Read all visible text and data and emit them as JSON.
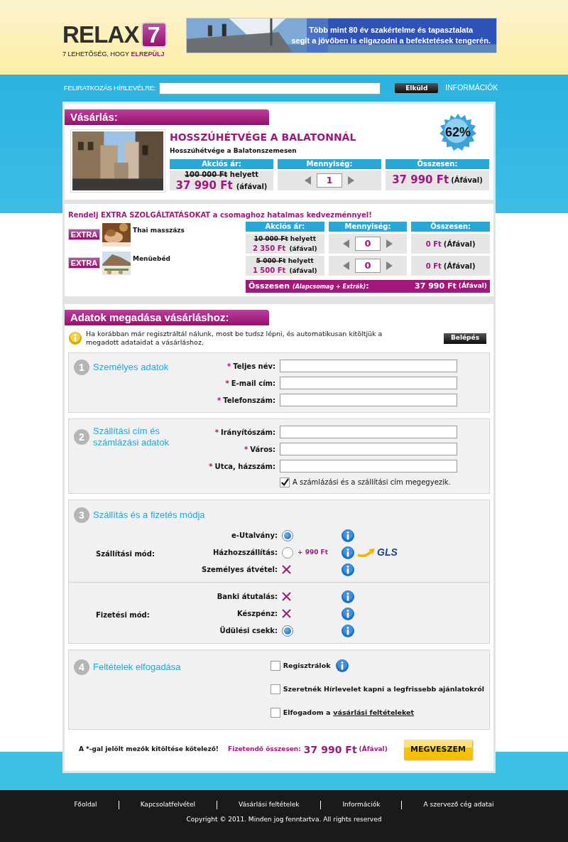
{
  "logo": {
    "wordmark": "RELAX",
    "number": "7",
    "tagline": "7 LEHETŐSÉG, HOGY **ELREPÜLJ**"
  },
  "banner": {
    "text": "Több mint 80 év szakértelme és tapasztalata\nsegít a jövőben is eligazodni a befektetések tengerén."
  },
  "newsletter": {
    "label": "FELIRATKOZÁS HÍRLEVÉLRE:",
    "button": "Elküld",
    "link": "INFORMÁCIÓK"
  },
  "purchase": {
    "heading": "Vásárlás:",
    "title": "HOSSZÚHÉTVÉGE A BALATONNÁL",
    "subtitle": "Hosszúhétvége a Balatonszemesen",
    "discount": "62%",
    "headers": [
      "Akciós ár:",
      "Mennyiség:",
      "Összesen:"
    ],
    "old_price": "100 000 Ft",
    "instead": "helyett",
    "price": "37 990 Ft",
    "price_vat": "(áfával)",
    "quantity": "1",
    "total": "37 990 Ft",
    "total_vat": "(Áfával)"
  },
  "extras": {
    "heading": "Rendelj EXTRA SZOLGÁLTATÁSOKAT a csomaghoz hatalmas kedvezménnyel!",
    "headers": [
      "Akciós ár:",
      "Mennyiség:",
      "Összesen:"
    ],
    "items": [
      {
        "badge": "EXTRA",
        "name": "Thai masszázs",
        "old_price": "10 000 Ft",
        "instead": "helyett",
        "price": "2 350 Ft",
        "price_vat": "(áfával)",
        "quantity": "0",
        "total": "0 Ft",
        "total_vat": "(Áfával)"
      },
      {
        "badge": "EXTRA",
        "name": "Menüebéd",
        "old_price": "5 000 Ft",
        "instead": "helyett",
        "price": "1 500 Ft",
        "price_vat": "(áfával)",
        "quantity": "0",
        "total": "0 Ft",
        "total_vat": "(Áfával)"
      }
    ],
    "sum": {
      "label": "Összesen *(Alapcsomag + Extrák)*:",
      "amount": "37 990 Ft",
      "vat": "(Áfával)"
    }
  },
  "form": {
    "heading": "Adatok megadása vásárláshoz:",
    "notice": "Ha korábban már regisztráltál nálunk, most be tudsz lépni, és automatikusan kitöltjük a megadott adataidat a vásárláshoz.",
    "login_button": "Belépés",
    "sections": [
      {
        "kind": "fields",
        "number": "1",
        "title": "Személyes adatok",
        "fields": [
          {
            "marker": "*",
            "label": "Teljes név:"
          },
          {
            "marker": "*",
            "label": "E-mail cím:"
          },
          {
            "marker": "*",
            "label": "Telefonszám:"
          }
        ]
      },
      {
        "kind": "fields",
        "number": "2",
        "title": "Szállítási cím és számlázási adatok",
        "fields": [
          {
            "marker": "*",
            "label": "Irányítószám:"
          },
          {
            "marker": "*",
            "label": "Város:"
          },
          {
            "marker": "*",
            "label": "Utca, házszám:"
          }
        ],
        "checkbox": {
          "label": "A számlázási és a szállítási cím megegyezik.",
          "checked": true
        }
      },
      {
        "kind": "options",
        "number": "3",
        "title": "Szállítás és a fizetés módja",
        "groups": [
          {
            "label": "Szállítási mód:",
            "options": [
              {
                "label": "e-Utalvány:",
                "kind": "radio",
                "selected": true
              },
              {
                "label": "Házhozszállítás:",
                "kind": "radio",
                "selected": false,
                "extra": "+ 990 Ft",
                "carrier": "GLS"
              },
              {
                "label": "Személyes átvétel:",
                "kind": "unavailable",
                "selected": false
              }
            ]
          },
          {
            "label": "Fizetési mód:",
            "options": [
              {
                "label": "Banki átutalás:",
                "kind": "unavailable",
                "selected": false
              },
              {
                "label": "Készpénz:",
                "kind": "unavailable",
                "selected": false
              },
              {
                "label": "Üdülési csekk:",
                "kind": "radio",
                "selected": true
              }
            ]
          }
        ]
      },
      {
        "kind": "terms",
        "number": "4",
        "title": "Feltételek elfogadása",
        "checkboxes": [
          {
            "label": "Regisztrálok",
            "checked": false,
            "info": true
          },
          {
            "label": "Szeretnék Hírlevelet kapni a legfrissebb ajánlatokról",
            "checked": false,
            "info": false
          },
          {
            "label": "Elfogadom a",
            "link": "vásárlási feltételeket",
            "checked": false,
            "info": false
          }
        ]
      }
    ],
    "required_note": "A *-gal jelölt mezők kitöltése kötelező!",
    "total_label": "Fizetendő összesen:",
    "total_amount": "37 990 Ft",
    "total_vat": "(Áfával)",
    "buy_button": "MEGVESZEM"
  },
  "footer": {
    "links": [
      "Főoldal",
      "Kapcsolatfelvétel",
      "Vásárlási feltételek",
      "Információk",
      "A szervező cég adatai"
    ],
    "copyright": "Copyright © 2011. Minden jog fenntartva. All rights reserved"
  }
}
